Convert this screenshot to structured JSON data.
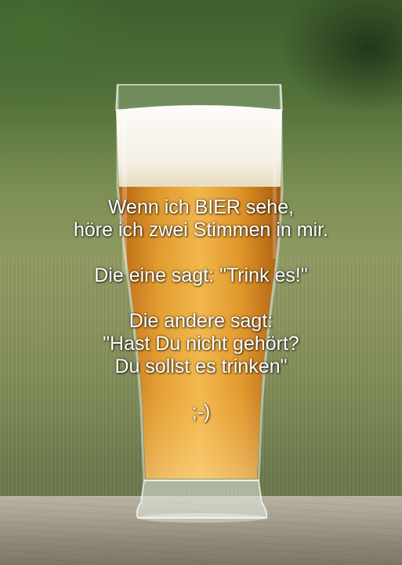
{
  "quote": {
    "line1": "Wenn ich BIER sehe,",
    "line2": "höre ich zwei Stimmen in mir.",
    "line3": "Die eine sagt: \"Trink es!\"",
    "line4": "Die andere sagt:",
    "line5": "\"Hast Du nicht gehört?",
    "line6": "Du sollst es trinken\"",
    "line7": ";-)"
  },
  "colors": {
    "beer": "#d98a1c",
    "foam": "#f7f4ec",
    "text": "#ffffff"
  }
}
